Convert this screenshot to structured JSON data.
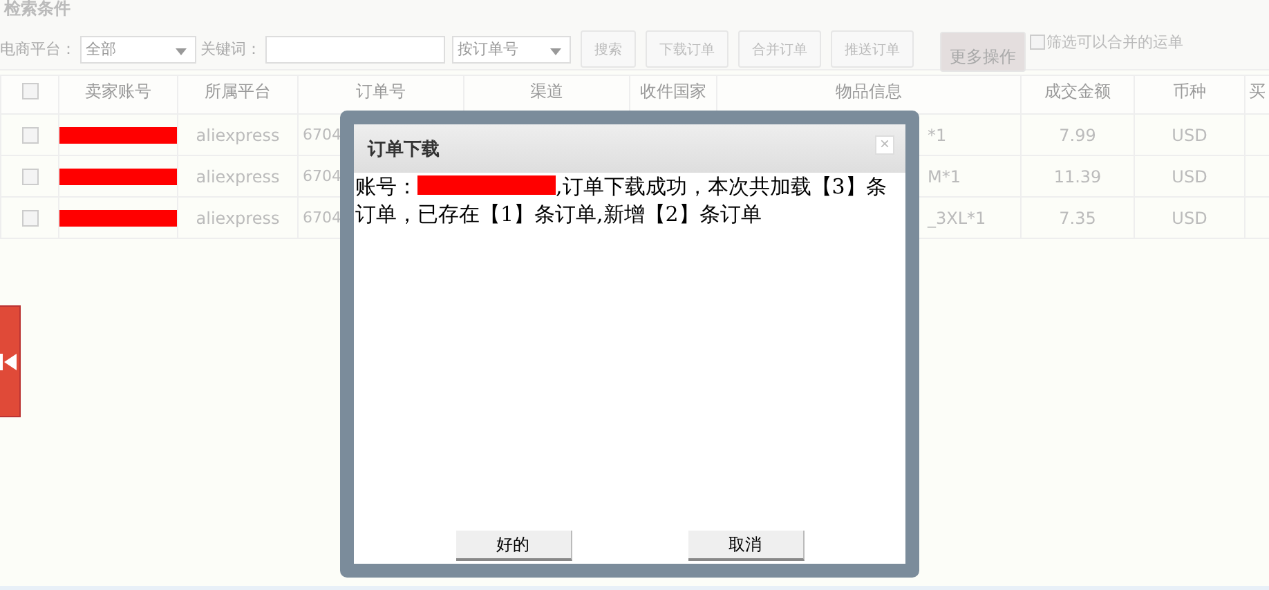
{
  "search_panel": {
    "title": "检索条件",
    "platform_label": "电商平台：",
    "platform_value": "全部",
    "keyword_label": "关键词：",
    "search_type": "按订单号",
    "buttons": [
      {
        "label": "搜索",
        "kind": "plain"
      },
      {
        "label": "下载订单",
        "kind": "plain"
      },
      {
        "label": "合并订单",
        "kind": "plain"
      },
      {
        "label": "推送订单",
        "kind": "plain"
      },
      {
        "label": "更多操作",
        "kind": "more"
      }
    ],
    "filter_checkbox": {
      "label": "筛选可以合并的运单",
      "checked": false
    }
  },
  "table": {
    "header_checked": false,
    "columns": [
      "卖家账号",
      "所属平台",
      "订单号",
      "渠道",
      "收件国家",
      "物品信息",
      "成交金额",
      "币种",
      "买"
    ],
    "rows": [
      {
        "checked": false,
        "seller_redacted": true,
        "platform": "aliexpress",
        "order_no": "6704",
        "item": "*1",
        "amount": "7.99",
        "currency": "USD"
      },
      {
        "checked": false,
        "seller_redacted": true,
        "platform": "aliexpress",
        "order_no": "6704",
        "item": "M*1",
        "amount": "11.39",
        "currency": "USD"
      },
      {
        "checked": false,
        "seller_redacted": true,
        "platform": "aliexpress",
        "order_no": "6704",
        "item": "_3XL*1",
        "amount": "7.35",
        "currency": "USD"
      }
    ]
  },
  "dialog": {
    "title": "订单下载",
    "close": "×",
    "message_prefix": "账号：",
    "account_redacted": true,
    "message_lines": [
      ",订单下载成功，本次共加载【3】条",
      "订单，已存在【1】条订单,新增【2】条订单"
    ],
    "buttons": [
      "好的",
      "取消"
    ]
  }
}
